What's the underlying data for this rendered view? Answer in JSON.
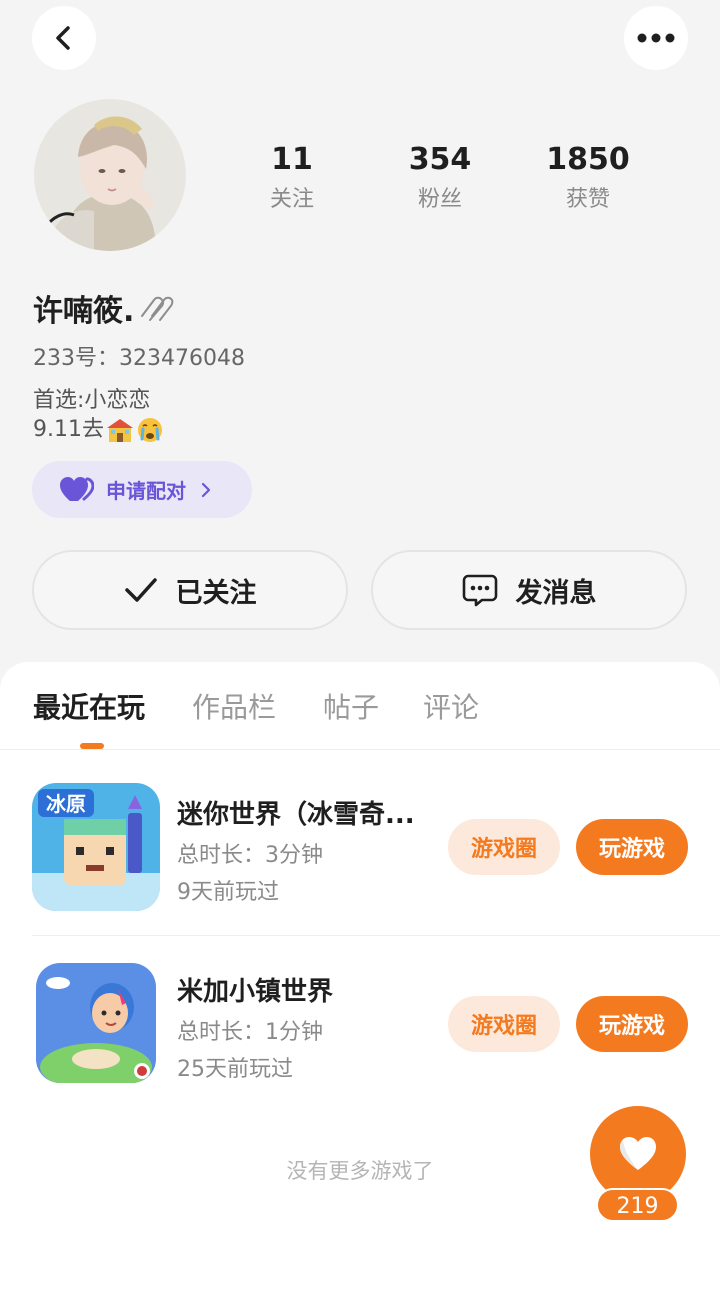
{
  "nav": {
    "back_icon": "chevron-left-icon",
    "more_icon": "more-dots-icon"
  },
  "profile": {
    "stats": [
      {
        "value": "11",
        "label": "关注"
      },
      {
        "value": "354",
        "label": "粉丝"
      },
      {
        "value": "1850",
        "label": "获赞"
      }
    ],
    "name": "许喃筱.",
    "uid": "233号：323476048",
    "bio_line1": "首选:小恋恋",
    "bio_line2": "9.11去"
  },
  "actions": {
    "pair_label": "申请配对",
    "followed_label": "已关注",
    "message_label": "发消息"
  },
  "tabs": [
    {
      "label": "最近在玩",
      "active": true
    },
    {
      "label": "作品栏",
      "active": false
    },
    {
      "label": "帖子",
      "active": false
    },
    {
      "label": "评论",
      "active": false
    }
  ],
  "games": [
    {
      "name": "迷你世界（冰雪奇...",
      "duration": "总时长：3分钟",
      "last_played": "9天前玩过",
      "icon_text": "冰原",
      "circle_label": "游戏圈",
      "play_label": "玩游戏"
    },
    {
      "name": "米加小镇世界",
      "duration": "总时长：1分钟",
      "last_played": "25天前玩过",
      "circle_label": "游戏圈",
      "play_label": "玩游戏"
    }
  ],
  "footer": {
    "no_more": "没有更多游戏了",
    "like_count": "219"
  },
  "colors": {
    "accent": "#f47a1f",
    "accent_light": "#fde9dc",
    "purple": "#6a55d8",
    "purple_bg": "#e9e6f8"
  }
}
